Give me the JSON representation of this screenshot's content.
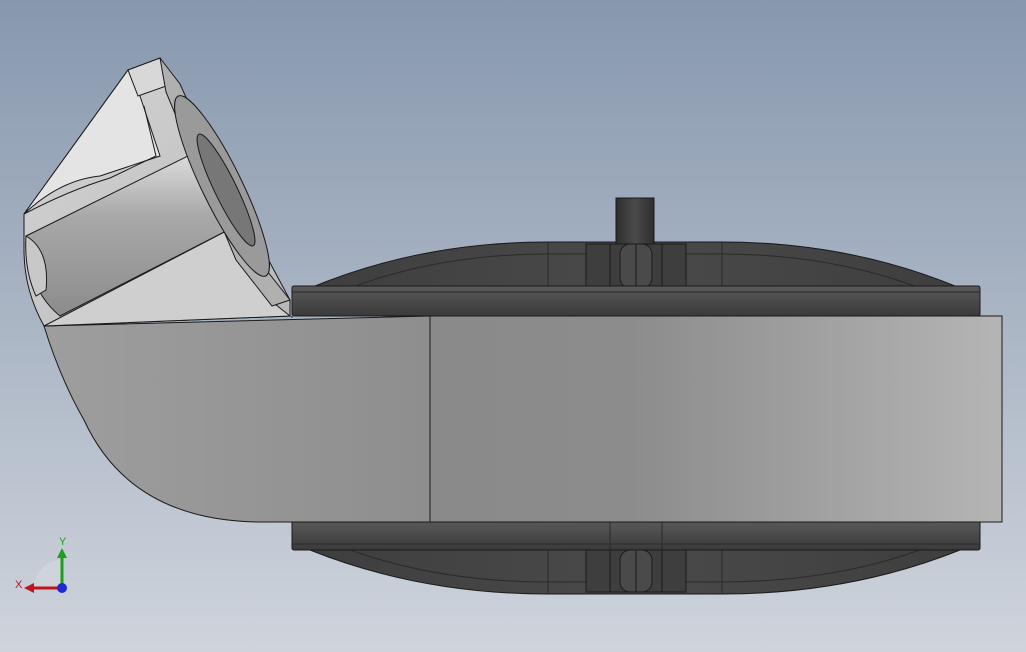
{
  "view": {
    "background_top": "#8798ae",
    "background_bottom": "#cfd4dc"
  },
  "triad": {
    "x_label": "X",
    "y_label": "Y",
    "x_color": "#c0141e",
    "y_color": "#1ea01e",
    "z_color": "#1e2ad8"
  },
  "colors": {
    "housing_light": "#c9c9c9",
    "housing_mid": "#a8a8a8",
    "housing_dark": "#8e8e8e",
    "rim_dark": "#3c3c3c",
    "rim_mid": "#4c4c4c",
    "edge": "#1a1a1a"
  },
  "icons": {
    "triad": "coordinate-triad-icon"
  }
}
